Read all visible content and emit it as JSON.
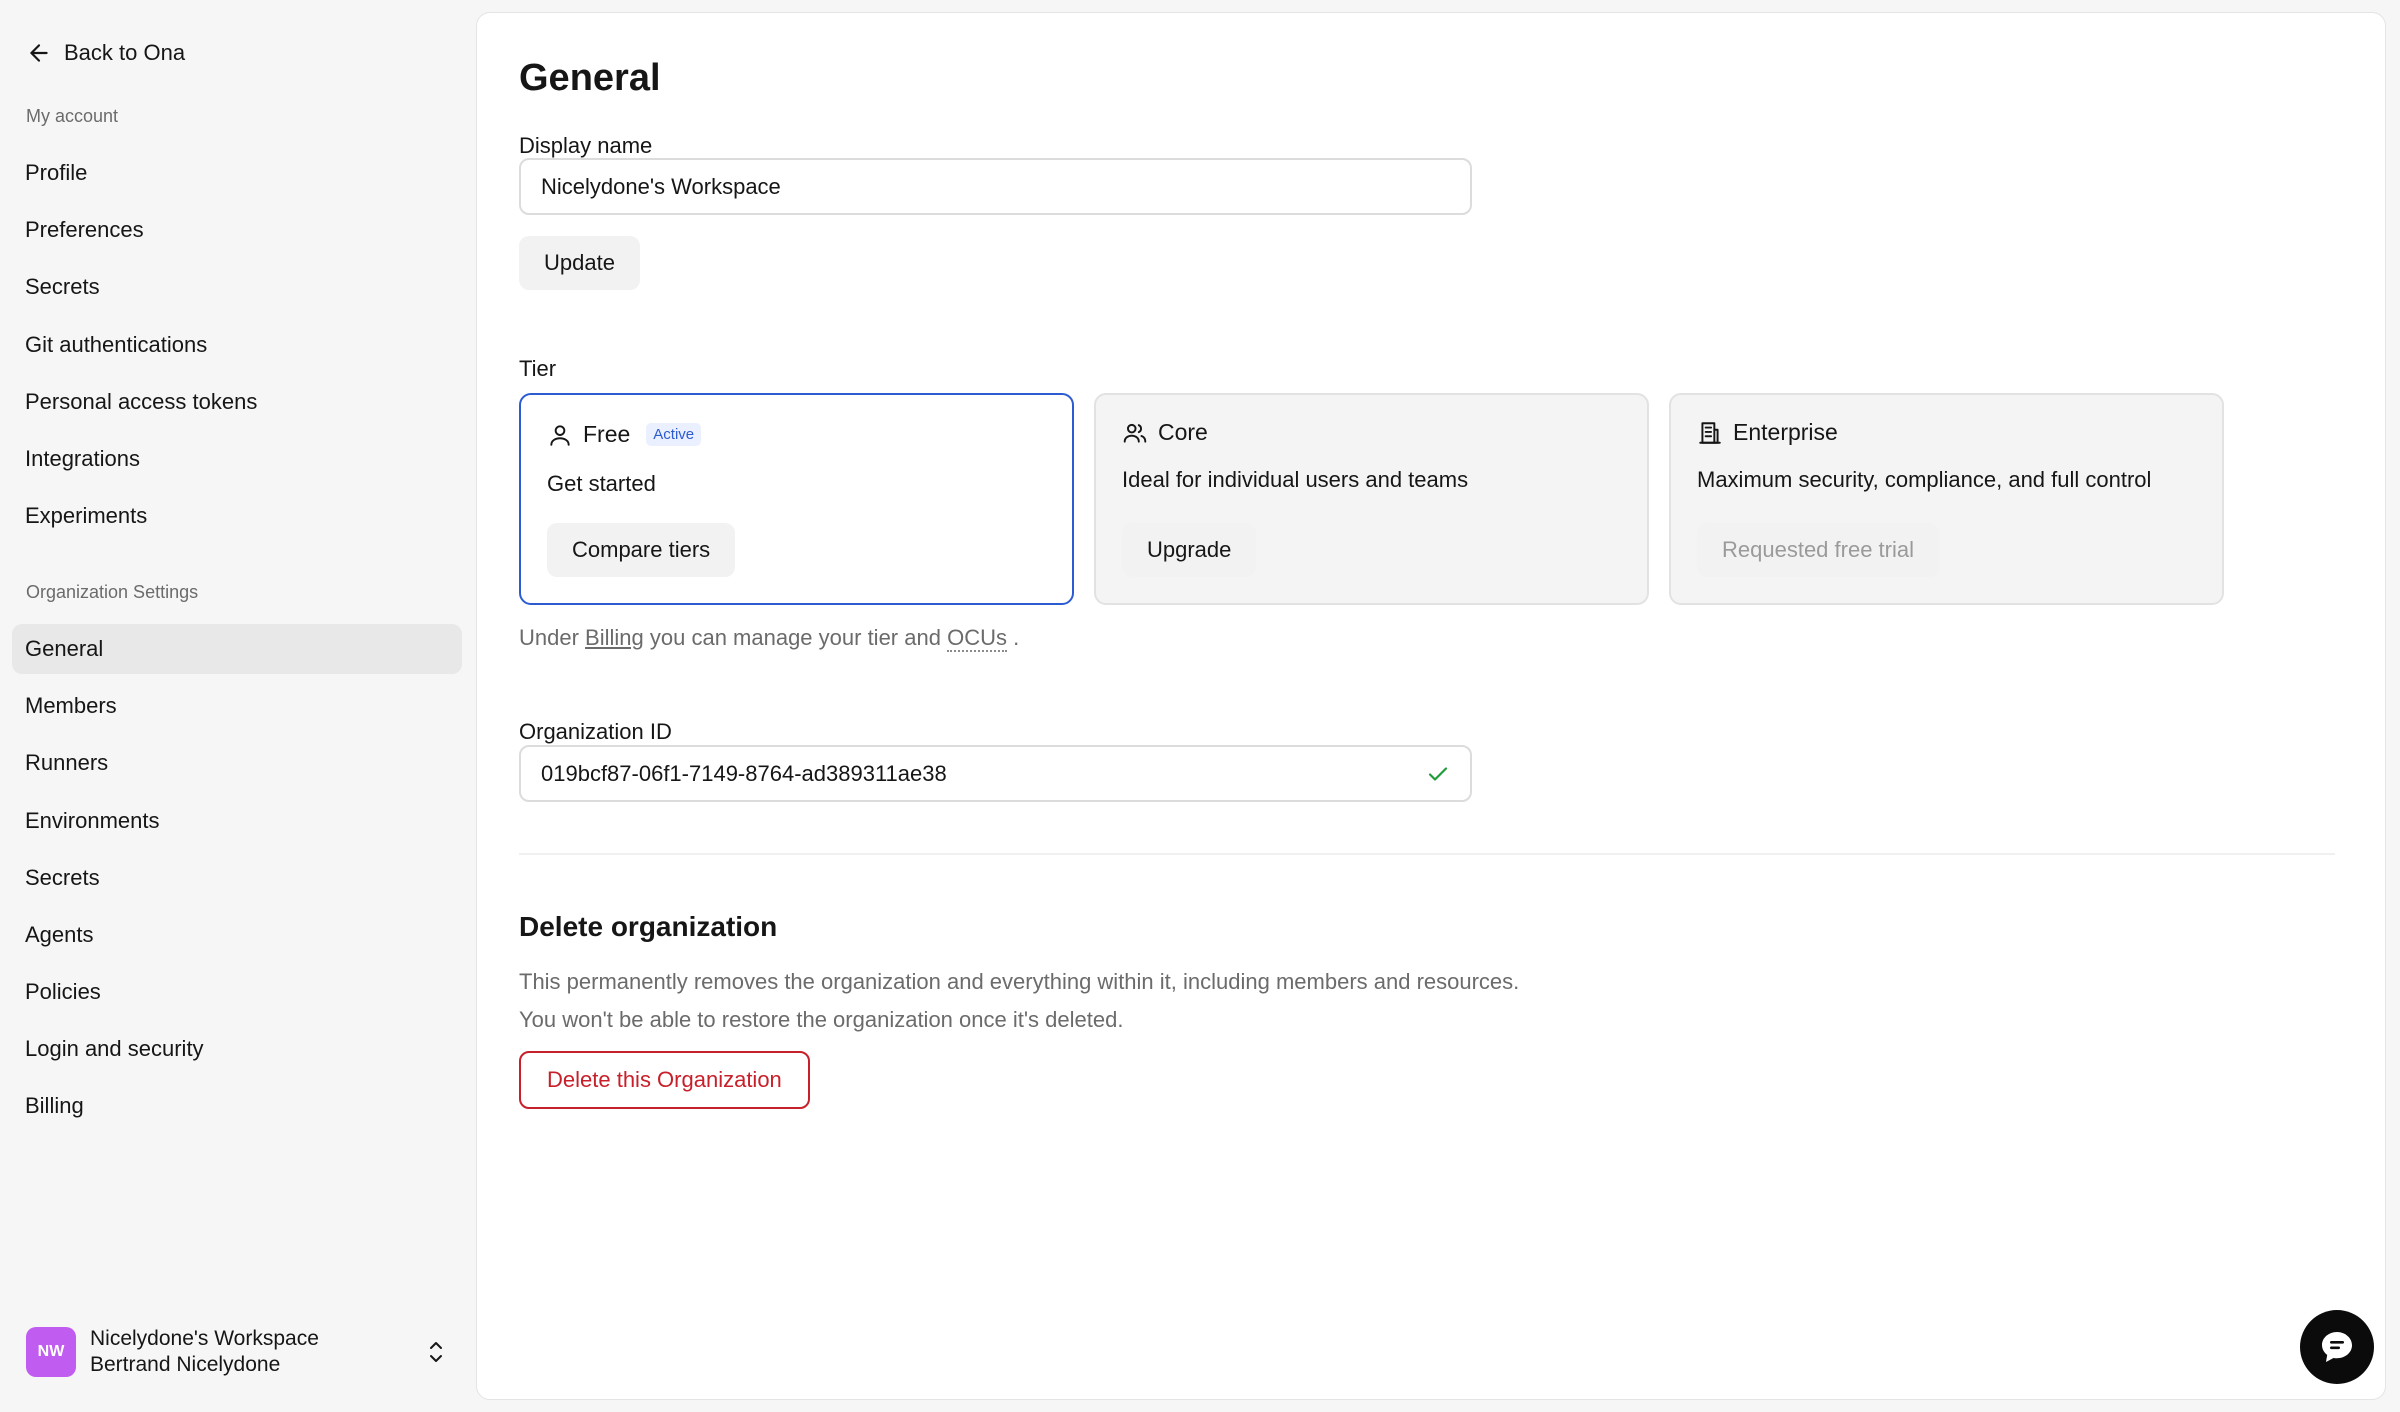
{
  "sidebar": {
    "back_label": "Back to Ona",
    "my_account_label": "My account",
    "account_items": [
      {
        "label": "Profile"
      },
      {
        "label": "Preferences"
      },
      {
        "label": "Secrets"
      },
      {
        "label": "Git authentications"
      },
      {
        "label": "Personal access tokens"
      },
      {
        "label": "Integrations"
      },
      {
        "label": "Experiments"
      }
    ],
    "org_settings_label": "Organization Settings",
    "org_items": [
      {
        "label": "General",
        "active": true
      },
      {
        "label": "Members"
      },
      {
        "label": "Runners"
      },
      {
        "label": "Environments"
      },
      {
        "label": "Secrets"
      },
      {
        "label": "Agents"
      },
      {
        "label": "Policies"
      },
      {
        "label": "Login and security"
      },
      {
        "label": "Billing"
      }
    ],
    "workspace": {
      "initials": "NW",
      "name": "Nicelydone's Workspace",
      "user": "Bertrand Nicelydone",
      "avatar_color": "#c15cf0"
    }
  },
  "main": {
    "title": "General",
    "display_name": {
      "label": "Display name",
      "value": "Nicelydone's Workspace",
      "update_label": "Update"
    },
    "tier": {
      "label": "Tier",
      "cards": [
        {
          "name": "Free",
          "badge": "Active",
          "description": "Get started",
          "button": "Compare tiers",
          "icon": "user-icon",
          "selected": true
        },
        {
          "name": "Core",
          "description": "Ideal for individual users and teams",
          "button": "Upgrade",
          "icon": "users-icon"
        },
        {
          "name": "Enterprise",
          "description": "Maximum security, compliance, and full control",
          "button": "Requested free trial",
          "icon": "building-icon",
          "disabled": true
        }
      ],
      "note_prefix": "Under",
      "note_billing_link": "Billing",
      "note_middle": "you can manage your tier and",
      "note_ocus": "OCUs",
      "note_suffix": "."
    },
    "organization_id": {
      "label": "Organization ID",
      "value": "019bcf87-06f1-7149-8764-ad389311ae38"
    },
    "delete": {
      "title": "Delete organization",
      "line1": "This permanently removes the organization and everything within it, including members and resources.",
      "line2": "You won't be able to restore the organization once it's deleted.",
      "button": "Delete this Organization"
    }
  },
  "colors": {
    "accent": "#2d5bd1",
    "danger": "#c8202a",
    "success": "#1f9d3a"
  }
}
